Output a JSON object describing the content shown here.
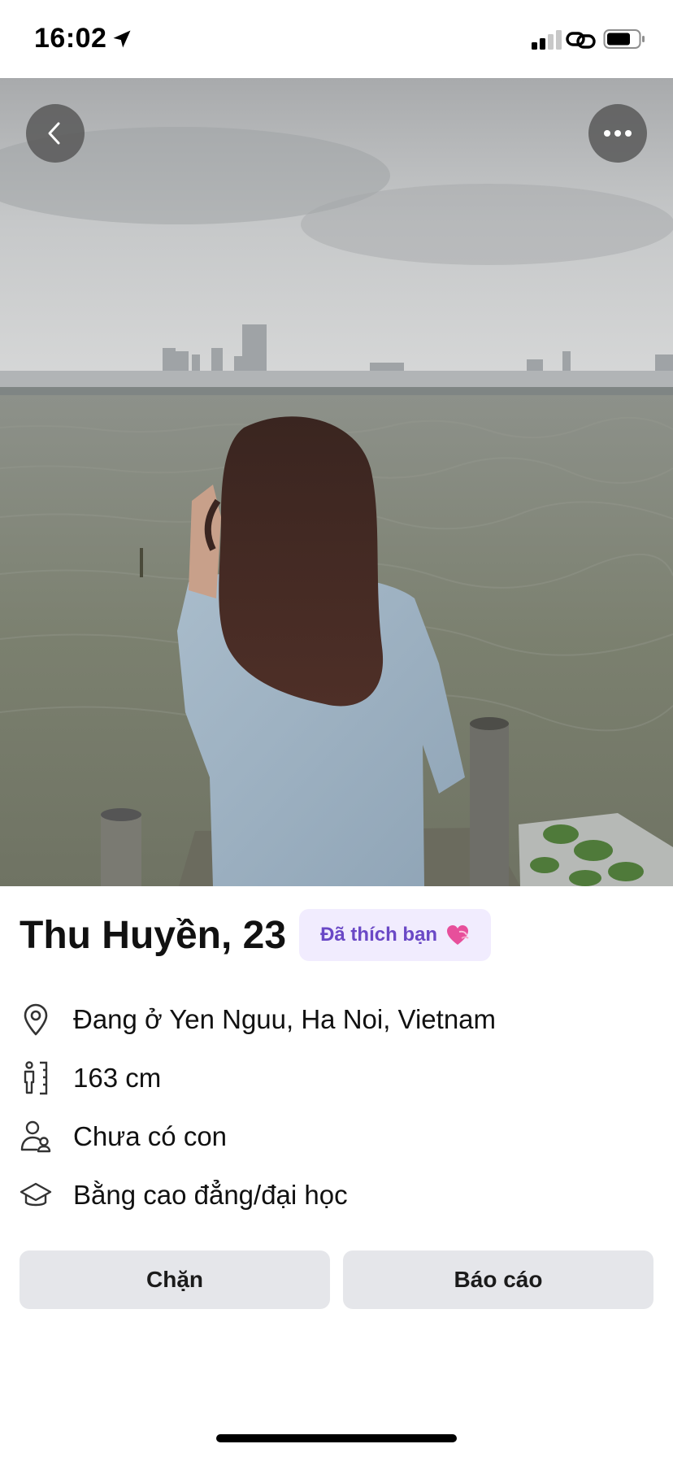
{
  "status_bar": {
    "time": "16:02",
    "icons": [
      "location-arrow-icon",
      "cellular-signal-icon",
      "personal-hotspot-icon",
      "battery-icon"
    ]
  },
  "photo": {
    "description_icons": [
      "back-chevron-icon",
      "more-ellipsis-icon"
    ]
  },
  "profile": {
    "name_age": "Thu Huyền, 23",
    "liked_badge": "Đã thích bạn",
    "liked_badge_icon": "heart-icon",
    "details": [
      {
        "icon": "location-pin-icon",
        "text": "Đang ở Yen Nguu, Ha Noi, Vietnam"
      },
      {
        "icon": "height-ruler-icon",
        "text": "163 cm"
      },
      {
        "icon": "children-icon",
        "text": "Chưa có con"
      },
      {
        "icon": "graduation-cap-icon",
        "text": "Bằng cao đẳng/đại học"
      }
    ]
  },
  "actions": {
    "block_label": "Chặn",
    "report_label": "Báo cáo"
  },
  "colors": {
    "badge_bg": "#f1ecfe",
    "badge_text": "#6a48c6",
    "button_bg": "#e5e6ea"
  }
}
